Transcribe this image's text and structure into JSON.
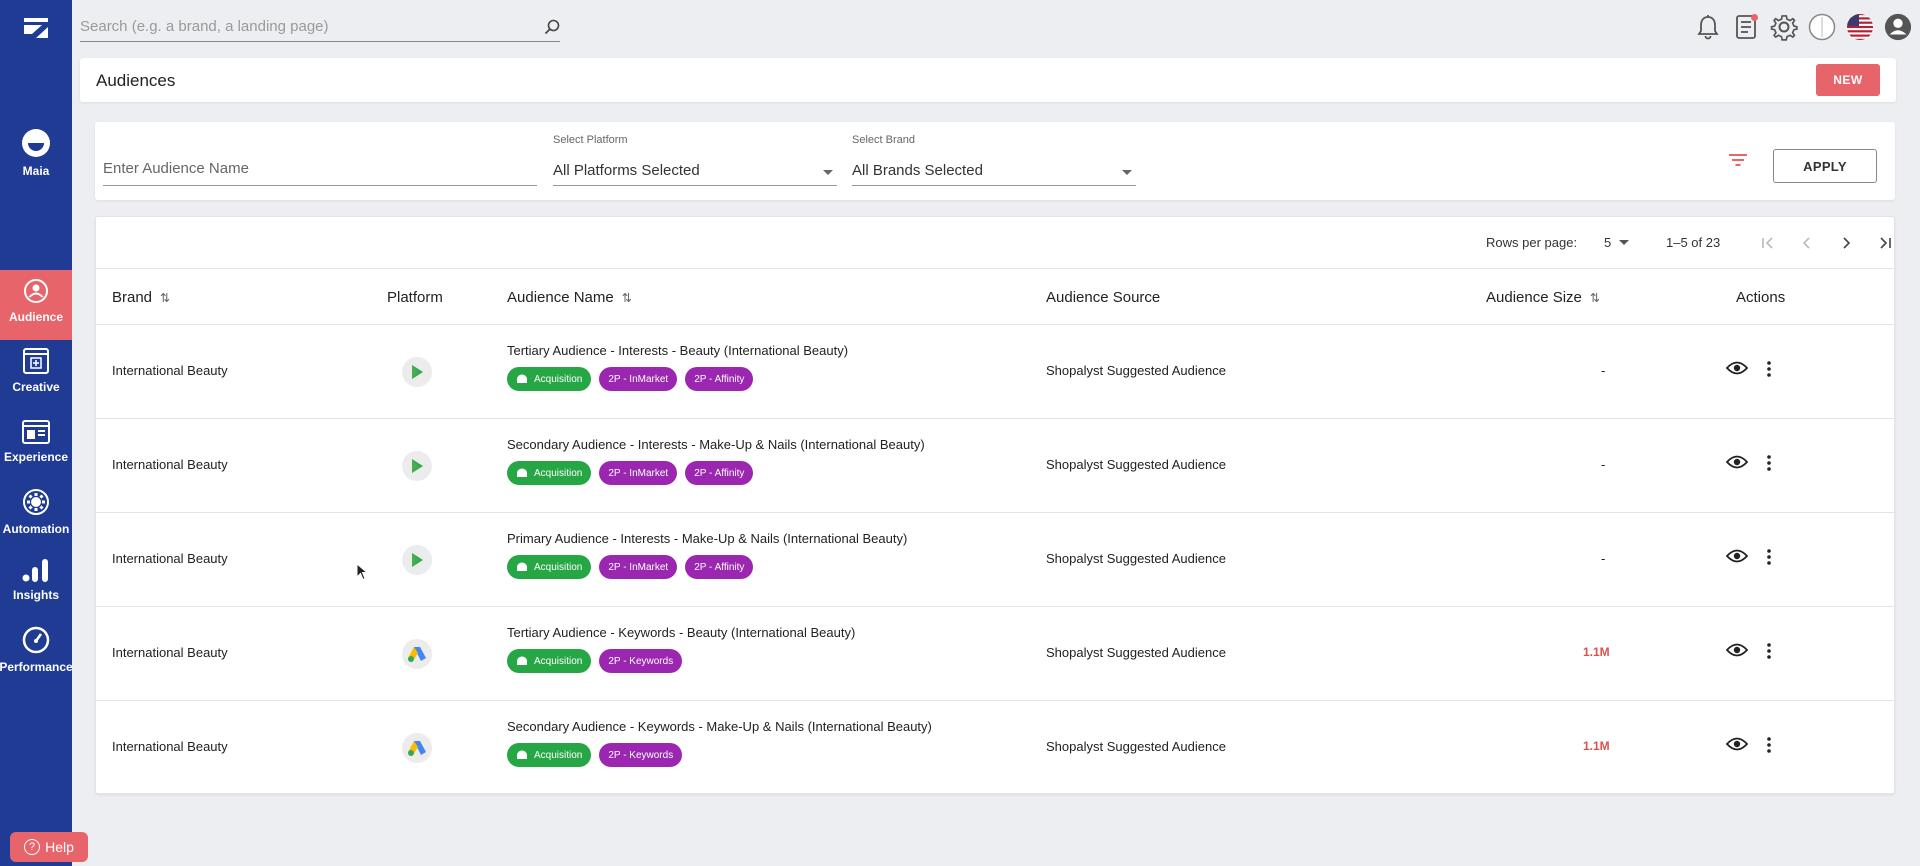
{
  "sidebar": {
    "items": [
      {
        "label": "Maia",
        "icon": "maia-icon"
      },
      {
        "label": "Audience",
        "icon": "audience-icon",
        "active": true
      },
      {
        "label": "Creative",
        "icon": "creative-icon"
      },
      {
        "label": "Experience",
        "icon": "experience-icon"
      },
      {
        "label": "Automation",
        "icon": "automation-icon"
      },
      {
        "label": "Insights",
        "icon": "insights-icon"
      },
      {
        "label": "Performance",
        "icon": "performance-icon"
      }
    ],
    "help_label": "Help"
  },
  "search": {
    "placeholder": "Search (e.g. a brand, a landing page)"
  },
  "header": {
    "title": "Audiences",
    "new_label": "NEW"
  },
  "filters": {
    "name_placeholder": "Enter Audience Name",
    "platform_label": "Select Platform",
    "platform_value": "All Platforms Selected",
    "brand_label": "Select Brand",
    "brand_value": "All Brands Selected",
    "apply_label": "APPLY"
  },
  "pagination": {
    "rows_label": "Rows per page:",
    "rows_value": "5",
    "range": "1–5 of 23"
  },
  "columns": {
    "brand": "Brand",
    "platform": "Platform",
    "name": "Audience Name",
    "source": "Audience Source",
    "size": "Audience Size",
    "actions": "Actions"
  },
  "rows": [
    {
      "brand": "International Beauty",
      "platform": "google-play",
      "name": "Tertiary Audience - Interests - Beauty (International Beauty)",
      "tags": [
        "Acquisition",
        "2P - InMarket",
        "2P - Affinity"
      ],
      "source": "Shopalyst Suggested Audience",
      "size": "-"
    },
    {
      "brand": "International Beauty",
      "platform": "google-play",
      "name": "Secondary Audience - Interests - Make-Up & Nails (International Beauty)",
      "tags": [
        "Acquisition",
        "2P - InMarket",
        "2P - Affinity"
      ],
      "source": "Shopalyst Suggested Audience",
      "size": "-"
    },
    {
      "brand": "International Beauty",
      "platform": "google-play",
      "name": "Primary Audience - Interests - Make-Up & Nails (International Beauty)",
      "tags": [
        "Acquisition",
        "2P - InMarket",
        "2P - Affinity"
      ],
      "source": "Shopalyst Suggested Audience",
      "size": "-"
    },
    {
      "brand": "International Beauty",
      "platform": "google-ads",
      "name": "Tertiary Audience - Keywords - Beauty (International Beauty)",
      "tags": [
        "Acquisition",
        "2P - Keywords"
      ],
      "source": "Shopalyst Suggested Audience",
      "size": "1.1M"
    },
    {
      "brand": "International Beauty",
      "platform": "google-ads",
      "name": "Secondary Audience - Keywords - Make-Up & Nails (International Beauty)",
      "tags": [
        "Acquisition",
        "2P - Keywords"
      ],
      "source": "Shopalyst Suggested Audience",
      "size": "1.1M"
    }
  ],
  "colors": {
    "sidebar": "#203b93",
    "accent": "#e8646b",
    "tag_green": "#27a645",
    "tag_purple": "#9b27b0"
  }
}
